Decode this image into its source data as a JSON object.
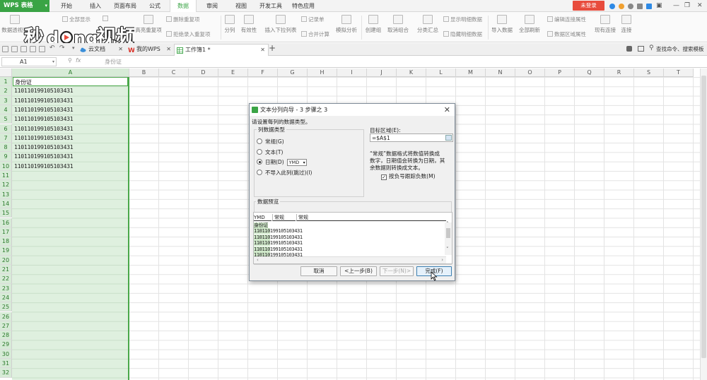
{
  "app": {
    "name": "WPS 表格"
  },
  "menu": [
    "开始",
    "插入",
    "页面布局",
    "公式",
    "数据",
    "审阅",
    "视图",
    "开发工具",
    "特色应用"
  ],
  "menu_active": "数据",
  "login_label": "未登录",
  "ribbon": {
    "pivot": "数据透视表",
    "show_all": "全部显示",
    "highlight_dup": "高亮重复项",
    "delete_dup": "删除重复项",
    "reject_dup": "拒绝录入重复项",
    "split": "分列",
    "validity": "有效性",
    "insert_dropdown": "插入下拉列表",
    "record_form": "记录单",
    "consolidate": "合并计算",
    "what_if": "模拟分析",
    "group": "创建组",
    "ungroup": "取消组合",
    "subtotal": "分类汇总",
    "show_detail": "显示明细数据",
    "hide_detail": "隐藏明细数据",
    "import": "导入数据",
    "refresh_all": "全部刷新",
    "edit_links": "编辑连接属性",
    "data_range_props": "数据区域属性",
    "existing_conn": "现有连接",
    "connect": "连接"
  },
  "tabs": {
    "cloud": "云文档",
    "my_wps": "我的WPS",
    "workbook": "工作簿1 *",
    "search_cmd": "查找命令、搜索模板"
  },
  "formula_bar": {
    "cell_ref": "A1",
    "fx": "fx",
    "content": "身份证"
  },
  "columns": [
    "A",
    "B",
    "C",
    "D",
    "E",
    "F",
    "G",
    "H",
    "I",
    "J",
    "K",
    "L",
    "M",
    "N",
    "O",
    "P",
    "Q",
    "R",
    "S",
    "T"
  ],
  "rows": [
    "1",
    "2",
    "3",
    "4",
    "5",
    "6",
    "7",
    "8",
    "9",
    "10",
    "11",
    "12",
    "13",
    "14",
    "15",
    "16",
    "17",
    "18",
    "19",
    "20",
    "21",
    "22",
    "23",
    "24",
    "25",
    "26",
    "27",
    "28",
    "29",
    "30",
    "31",
    "32"
  ],
  "cells_A": [
    "身份证",
    "110110199105103431",
    "110110199105103431",
    "110110199105103431",
    "110110199105103431",
    "110110199105103431",
    "110110199105103431",
    "110110199105103431",
    "110110199105103431",
    "110110199105103431"
  ],
  "dialog": {
    "title": "文本分列向导 - 3 步骤之 3",
    "instruction": "请设置每列的数据类型。",
    "column_type_label": "列数据类型",
    "opt_general": "常规(G)",
    "opt_text": "文本(T)",
    "opt_date": "日期(D)",
    "date_format": "YMD",
    "opt_skip": "不导入此列(跳过)(I)",
    "target_label": "目标区域(E):",
    "target_value": "=$A$1",
    "note_line1": "“常规”数据格式将数值转换成",
    "note_line2": "数字，日期值会转换为日期，其",
    "note_line3": "余数据则转换成文本。",
    "negative_label": "按负号跟踪负数(M)",
    "preview_label": "数据预览",
    "preview_headers": [
      "YMD",
      "常规",
      "常规"
    ],
    "preview_rows": [
      "身份证",
      "110110199105103431",
      "110110199105103431",
      "110110199105103431",
      "110110199105103431",
      "110110199105103431"
    ],
    "btn_cancel": "取消",
    "btn_back": "<上一步(B)",
    "btn_next": "下一步(N)>",
    "btn_finish": "完成(F)"
  }
}
